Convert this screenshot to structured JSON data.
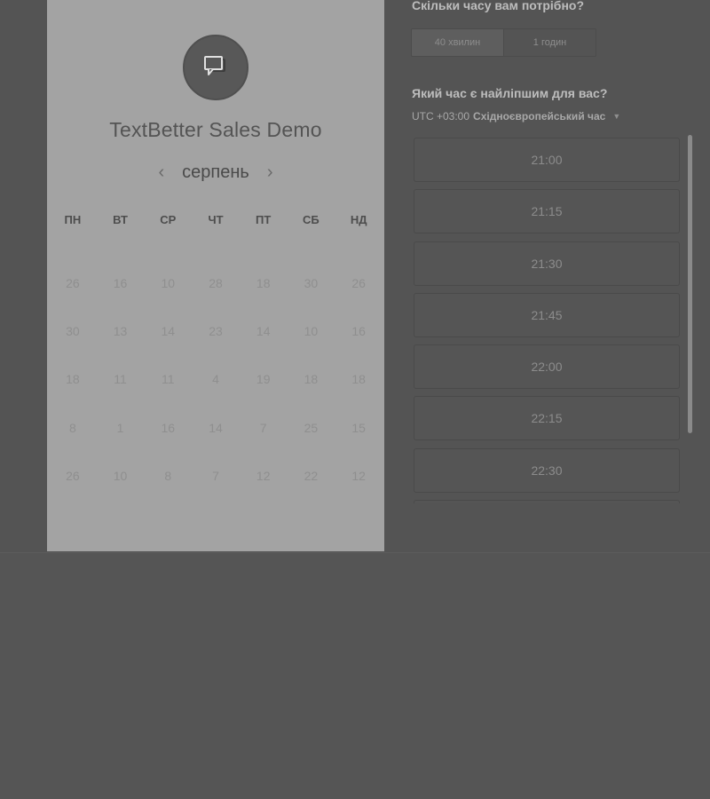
{
  "organizer": {
    "title": "TextBetter Sales Demo",
    "logo_icon": "chat-bubble-icon"
  },
  "calendar": {
    "month_label": "серпень",
    "prev_icon": "‹",
    "next_icon": "›",
    "weekdays": [
      "ПН",
      "ВТ",
      "СР",
      "ЧТ",
      "ПТ",
      "СБ",
      "НД"
    ],
    "weeks": [
      [
        "26",
        "16",
        "10",
        "28",
        "18",
        "30",
        "26"
      ],
      [
        "30",
        "13",
        "14",
        "23",
        "14",
        "10",
        "16"
      ],
      [
        "18",
        "11",
        "11",
        "4",
        "19",
        "18",
        "18"
      ],
      [
        "8",
        "1",
        "16",
        "14",
        "7",
        "25",
        "15"
      ],
      [
        "26",
        "10",
        "8",
        "7",
        "12",
        "22",
        "12"
      ]
    ]
  },
  "duration": {
    "heading": "Скільки часу вам потрібно?",
    "options": [
      "40 хвилин",
      "1 годин"
    ],
    "selected_index": 0
  },
  "time_selection": {
    "heading": "Який час є найліпшим для вас?",
    "timezone_offset": "UTC +03:00",
    "timezone_name": "Східноєвропейський час",
    "slots": [
      "21:00",
      "21:15",
      "21:30",
      "21:45",
      "22:00",
      "22:15",
      "22:30",
      ""
    ]
  },
  "colors": {
    "overlay": "#555555",
    "left_panel": "#a3a3a3"
  }
}
